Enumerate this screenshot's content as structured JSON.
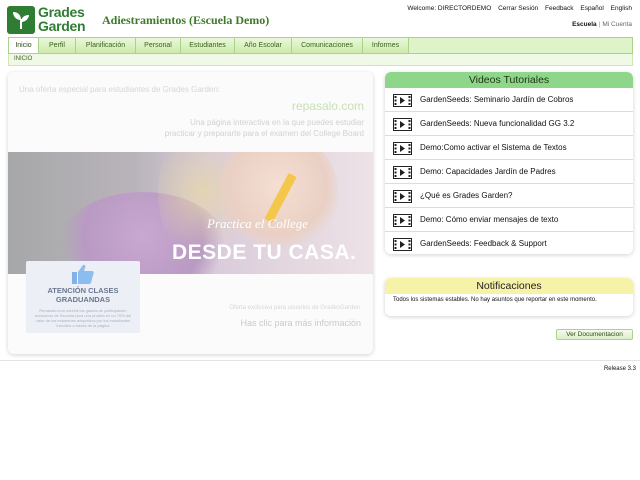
{
  "header": {
    "logo_line1": "Grades",
    "logo_line2": "Garden",
    "school_title": "Adiestramientos (Escuela Demo)",
    "welcome": "Welcome: DIRECTORDEMO",
    "logout": "Cerrar Sesión",
    "feedback": "Feedback",
    "lang_es": "Español",
    "lang_en": "English",
    "school_link": "Escuela",
    "account_link": "Mi Cuenta"
  },
  "nav": {
    "tabs": [
      "Inicio",
      "Perfil",
      "Planificación",
      "Personal",
      "Estudiantes",
      "Año Escolar",
      "Comunicaciones",
      "Informes"
    ],
    "active": "Inicio",
    "breadcrumb": "INICIO"
  },
  "promo": {
    "offer": "Una oferta especial para estudiantes de Grades Garden:",
    "site": "repasalo.com",
    "description": "Una página interactiva en la que puedes estudiar practicar y prepararte para el examen del College Board",
    "practica": "Practica el College",
    "desde": "DESDE TU CASA.",
    "badge_title": "ATENCIÓN CLASES GRADUANDAS",
    "badge_text": "Repasalo.com cubrirá los gastos de participación exclusivos de Escuela para una prueba en un 70% del valor de los exámenes adquiridos por los estudiantes inscritos a través de la página",
    "exclusive": "Oferta exclusiva para usuarios de GradesGarden",
    "click": "Has clic para más información"
  },
  "videos": {
    "title": "Videos Tutoriales",
    "items": [
      "GardenSeeds: Seminario Jardín de Cobros",
      "GardenSeeds: Nueva funcionalidad GG 3.2",
      "Demo:Como activar el Sistema de Textos",
      "Demo: Capacidades Jardín de Padres",
      "¿Qué es Grades Garden?",
      "Demo: Cómo enviar mensajes de texto",
      "GardenSeeds: Feedback & Support"
    ]
  },
  "notifications": {
    "title": "Notificaciones",
    "text": "Todos los sistemas estables. No hay asuntos que reportar en este momento."
  },
  "doc_button": "Ver Documentacion",
  "release": "Release 3.3",
  "colors": {
    "brand_green": "#2e7d32",
    "nav_bg": "#dff3c8",
    "videos_header": "#8ed68a",
    "notif_header": "#f6f2a8"
  }
}
